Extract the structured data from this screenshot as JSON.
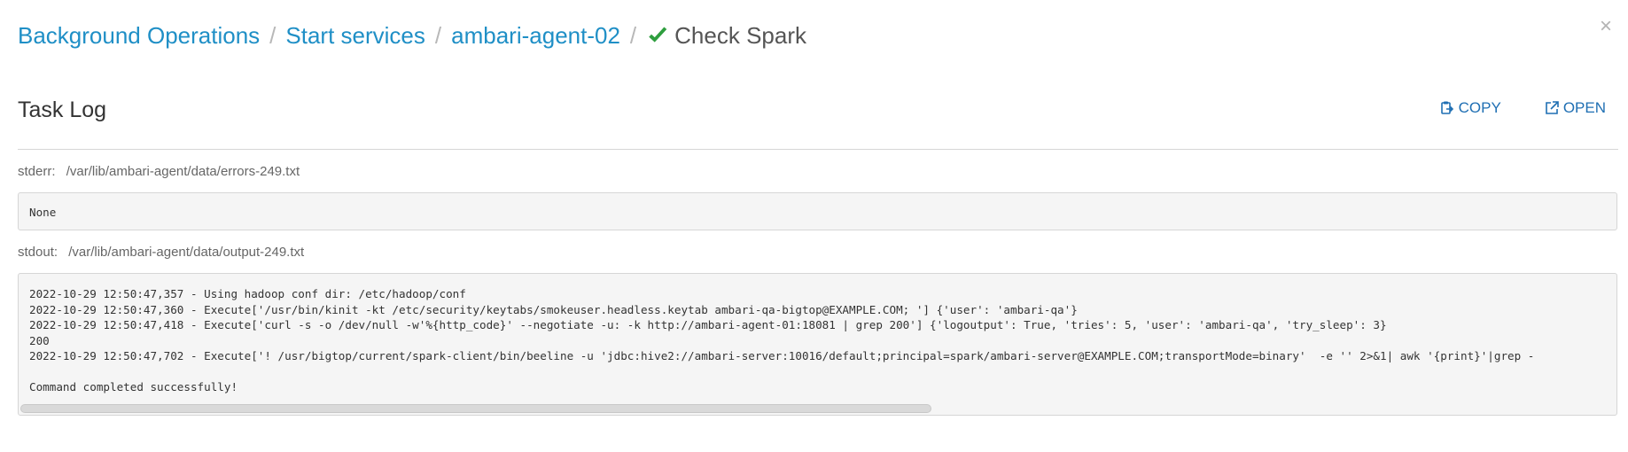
{
  "breadcrumb": {
    "items": [
      {
        "label": "Background Operations"
      },
      {
        "label": "Start services"
      },
      {
        "label": "ambari-agent-02"
      }
    ],
    "separator": "/",
    "current": "Check Spark",
    "current_icon": "check-icon",
    "check_color": "#2e9e3e",
    "link_color": "#1f8fc6"
  },
  "close_glyph": "×",
  "task_log": {
    "title": "Task Log",
    "copy_label": "COPY",
    "open_label": "OPEN",
    "copy_icon": "clipboard-icon",
    "open_icon": "external-link-icon"
  },
  "stderr": {
    "label": "stderr:",
    "path": "/var/lib/ambari-agent/data/errors-249.txt",
    "content": "None"
  },
  "stdout": {
    "label": "stdout:",
    "path": "/var/lib/ambari-agent/data/output-249.txt",
    "lines": [
      "2022-10-29 12:50:47,357 - Using hadoop conf dir: /etc/hadoop/conf",
      "2022-10-29 12:50:47,360 - Execute['/usr/bin/kinit -kt /etc/security/keytabs/smokeuser.headless.keytab ambari-qa-bigtop@EXAMPLE.COM; '] {'user': 'ambari-qa'}",
      "2022-10-29 12:50:47,418 - Execute['curl -s -o /dev/null -w'%{http_code}' --negotiate -u: -k http://ambari-agent-01:18081 | grep 200'] {'logoutput': True, 'tries': 5, 'user': 'ambari-qa', 'try_sleep': 3}",
      "200",
      "2022-10-29 12:50:47,702 - Execute['! /usr/bigtop/current/spark-client/bin/beeline -u 'jdbc:hive2://ambari-server:10016/default;principal=spark/ambari-server@EXAMPLE.COM;transportMode=binary'  -e '' 2>&1| awk '{print}'|grep -",
      "",
      "Command completed successfully!"
    ]
  }
}
